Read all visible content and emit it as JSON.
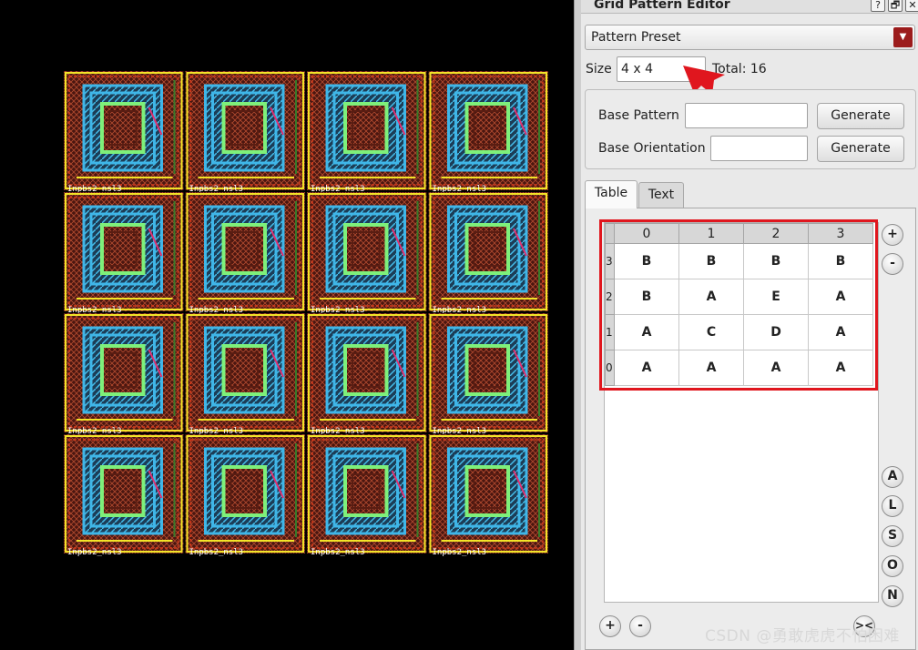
{
  "window": {
    "title": "Grid Pattern Editor",
    "help_label": "?",
    "float_label": "🗗",
    "close_label": "✕"
  },
  "preset": {
    "label": "Pattern Preset"
  },
  "size": {
    "label": "Size",
    "value": "4 x 4",
    "total_label": "Total: 16"
  },
  "base": {
    "pattern_label": "Base Pattern",
    "pattern_value": "",
    "orientation_label": "Base Orientation",
    "orientation_value": "",
    "generate_label": "Generate"
  },
  "tabs": [
    {
      "label": "Table",
      "active": true
    },
    {
      "label": "Text",
      "active": false
    }
  ],
  "grid": {
    "columns": [
      "0",
      "1",
      "2",
      "3"
    ],
    "rows": [
      {
        "index": "3",
        "cells": [
          "B",
          "B",
          "B",
          "B"
        ]
      },
      {
        "index": "2",
        "cells": [
          "B",
          "A",
          "E",
          "A"
        ]
      },
      {
        "index": "1",
        "cells": [
          "A",
          "C",
          "D",
          "A"
        ]
      },
      {
        "index": "0",
        "cells": [
          "A",
          "A",
          "A",
          "A"
        ]
      }
    ]
  },
  "side_buttons": {
    "add_col": "+",
    "remove_col": "-",
    "letters": [
      "A",
      "L",
      "S",
      "O",
      "N"
    ],
    "add_row": "+",
    "remove_row": "-",
    "collapse": "><"
  },
  "canvas": {
    "instance_label": "Inpbs2_nsl3",
    "grid_rows": 4,
    "grid_cols": 4
  },
  "watermark": "CSDN @勇敢虎虎不怕困难",
  "colors": {
    "accent_red": "#e0161e",
    "dropdown_red": "#9c1c1c",
    "layout_green": "#7ef07a",
    "layout_cyan": "#3fb6e8",
    "layout_yellow": "#f2e428",
    "layout_red": "#d93a1a",
    "layout_brown": "#5a1d12"
  }
}
